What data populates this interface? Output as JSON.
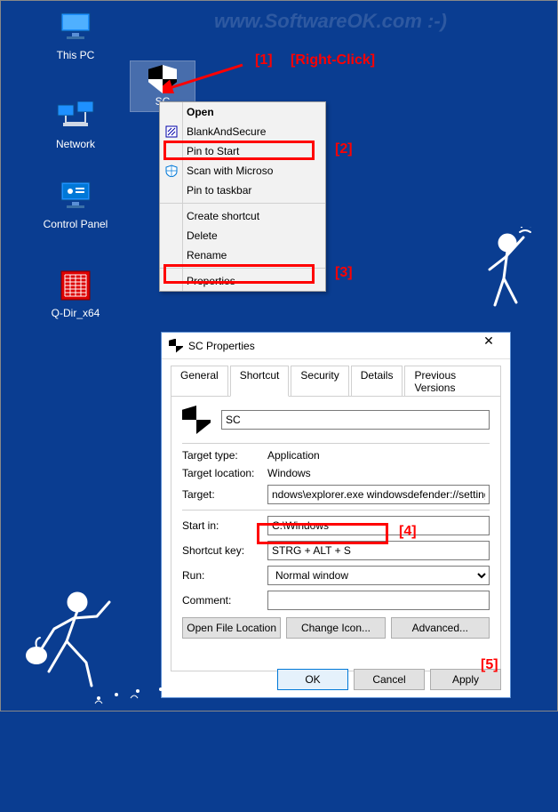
{
  "watermark": "www.SoftwareOK.com :-)",
  "desktop": {
    "thispc": "This PC",
    "sc": "SC",
    "network": "Network",
    "cpanel": "Control Panel",
    "qdir": "Q-Dir_x64"
  },
  "context_menu": {
    "open": "Open",
    "blankandsecure": "BlankAndSecure",
    "pin_to_start": "Pin to Start",
    "scan": "Scan with Microso",
    "pin_to_taskbar": "Pin to taskbar",
    "create_shortcut": "Create shortcut",
    "delete": "Delete",
    "rename": "Rename",
    "properties": "Properties"
  },
  "props": {
    "title": "SC Properties",
    "tabs": {
      "general": "General",
      "shortcut": "Shortcut",
      "security": "Security",
      "details": "Details",
      "previous": "Previous Versions"
    },
    "name_field": "SC",
    "target_type_lbl": "Target type:",
    "target_type_val": "Application",
    "target_loc_lbl": "Target location:",
    "target_loc_val": "Windows",
    "target_lbl": "Target:",
    "target_val": "ndows\\explorer.exe windowsdefender://settings/",
    "start_in_lbl": "Start in:",
    "start_in_val": "C:\\Windows",
    "shortcut_key_lbl": "Shortcut key:",
    "shortcut_key_val": "STRG + ALT + S",
    "run_lbl": "Run:",
    "run_val": "Normal window",
    "comment_lbl": "Comment:",
    "comment_val": "",
    "open_file_location": "Open File Location",
    "change_icon": "Change Icon...",
    "advanced": "Advanced...",
    "ok": "OK",
    "cancel": "Cancel",
    "apply": "Apply"
  },
  "annotations": {
    "a1": "[1]",
    "a1b": "[Right-Click]",
    "a2": "[2]",
    "a3": "[3]",
    "a4": "[4]",
    "a5": "[5]"
  }
}
